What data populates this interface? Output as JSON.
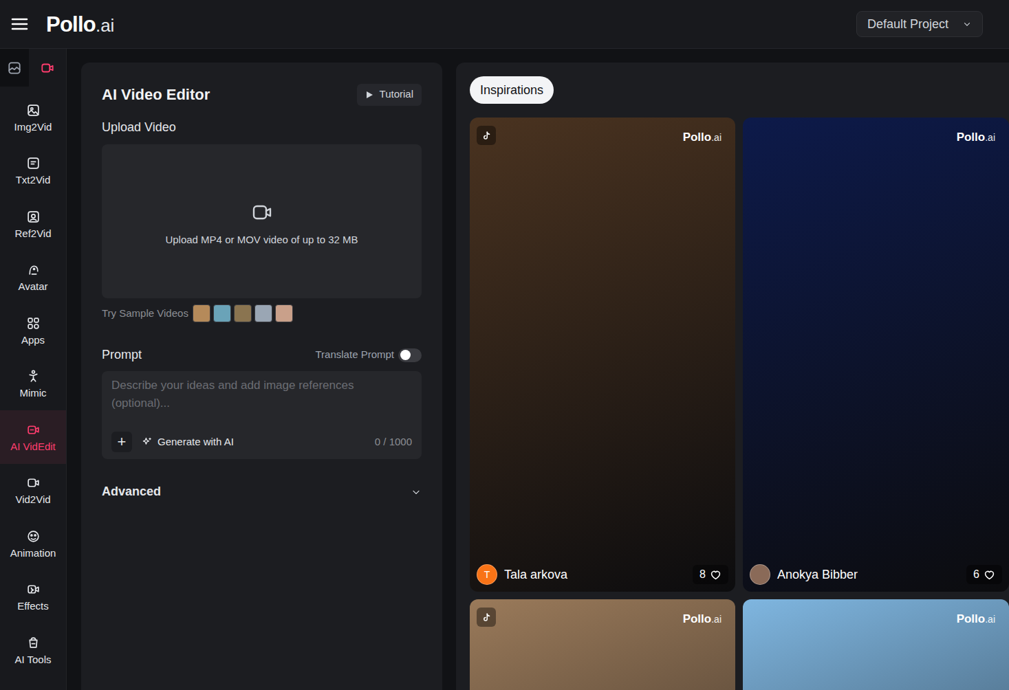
{
  "topbar": {
    "logo": {
      "brand": "Pollo",
      "suffix": ".ai"
    },
    "project": "Default Project"
  },
  "sidebar": {
    "tabs": [
      {
        "kind": "image",
        "selected": false
      },
      {
        "kind": "video",
        "selected": true
      }
    ],
    "items": [
      {
        "label": "Img2Vid",
        "selected": false
      },
      {
        "label": "Txt2Vid",
        "selected": false
      },
      {
        "label": "Ref2Vid",
        "selected": false
      },
      {
        "label": "Avatar",
        "selected": false
      },
      {
        "label": "Apps",
        "selected": false
      },
      {
        "label": "Mimic",
        "selected": false
      },
      {
        "label": "AI VidEdit",
        "selected": true
      },
      {
        "label": "Vid2Vid",
        "selected": false
      },
      {
        "label": "Animation",
        "selected": false
      },
      {
        "label": "Effects",
        "selected": false
      },
      {
        "label": "AI Tools",
        "selected": false
      }
    ]
  },
  "editor": {
    "title": "AI Video Editor",
    "tutorial": "Tutorial",
    "upload_label": "Upload Video",
    "upload_hint": "Upload MP4 or MOV video of up to 32 MB",
    "samples_label": "Try Sample Videos",
    "samples": [
      {
        "color": "#b58a5a"
      },
      {
        "color": "#6aa3b8"
      },
      {
        "color": "#8a7450"
      },
      {
        "color": "#9aa6b4"
      },
      {
        "color": "#c9a08a"
      }
    ],
    "prompt": {
      "label": "Prompt",
      "translate_label": "Translate Prompt",
      "translate_on": false,
      "placeholder": "Describe your ideas and add image references (optional)...",
      "add": "+",
      "generate": "Generate with AI",
      "counter": "0 / 1000"
    },
    "advanced": {
      "label": "Advanced",
      "expanded": false
    }
  },
  "inspirations": {
    "tab": {
      "label": "Inspirations",
      "selected": true
    },
    "cards": [
      {
        "color": "#4a3320",
        "tiktok": true,
        "watermark": {
          "brand": "Pollo",
          "suffix": ".ai"
        },
        "author": {
          "name": "Tala arkova",
          "initial": "T",
          "color": "#f97316"
        },
        "likes": "8"
      },
      {
        "color": "#0d1a4a",
        "tiktok": false,
        "watermark": {
          "brand": "Pollo",
          "suffix": ".ai"
        },
        "author": {
          "name": "Anokya Bibber",
          "initial": "",
          "color": "#8a6a58"
        },
        "likes": "6"
      },
      {
        "color": "#9a7a5a",
        "tiktok": true,
        "watermark": {
          "brand": "Pollo",
          "suffix": ".ai"
        },
        "author": null,
        "likes": null
      },
      {
        "color": "#7fb6e0",
        "tiktok": false,
        "watermark": {
          "brand": "Pollo",
          "suffix": ".ai"
        },
        "author": null,
        "likes": null
      }
    ]
  }
}
